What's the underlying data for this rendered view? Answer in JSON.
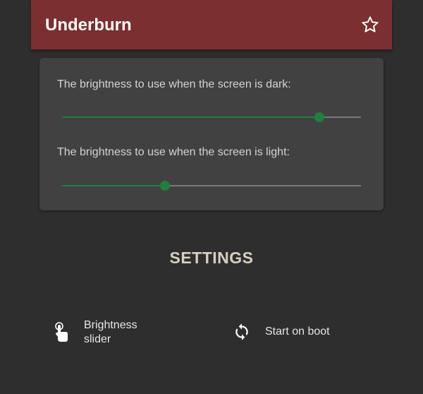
{
  "app_bar": {
    "title": "Underburn",
    "favorite_icon": "star-outline-icon",
    "background_color": "#7b2f30"
  },
  "brightness_card": {
    "dark": {
      "label": "The brightness to use when the screen is dark:",
      "level": 0.86
    },
    "light": {
      "label": "The brightness to use when the screen is light:",
      "level": 0.345
    },
    "accent_color": "#1e7f3f"
  },
  "settings": {
    "heading": "SETTINGS",
    "actions": [
      {
        "label_line1": "Brightness",
        "label_line2": "slider",
        "icon": "touch-hand-icon"
      },
      {
        "label": "Start on boot",
        "icon": "sync-icon"
      }
    ]
  }
}
